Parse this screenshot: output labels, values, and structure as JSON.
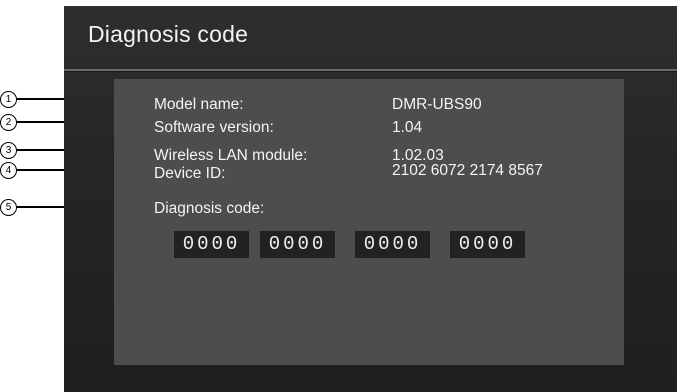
{
  "screen": {
    "title": "Diagnosis code"
  },
  "info": {
    "model_name_label": "Model name:",
    "model_name_value": "DMR-UBS90",
    "software_version_label": "Software version:",
    "software_version_value": "1.04",
    "wireless_lan_label": "Wireless LAN module:",
    "wireless_lan_value": "1.02.03",
    "device_id_label": "Device ID:",
    "device_id_value": "2102 6072 2174 8567",
    "diagnosis_code_label": "Diagnosis code:"
  },
  "diagnosis_code": [
    "0000",
    "0000",
    "0000",
    "0000"
  ],
  "callouts": [
    "1",
    "2",
    "3",
    "4",
    "5"
  ]
}
